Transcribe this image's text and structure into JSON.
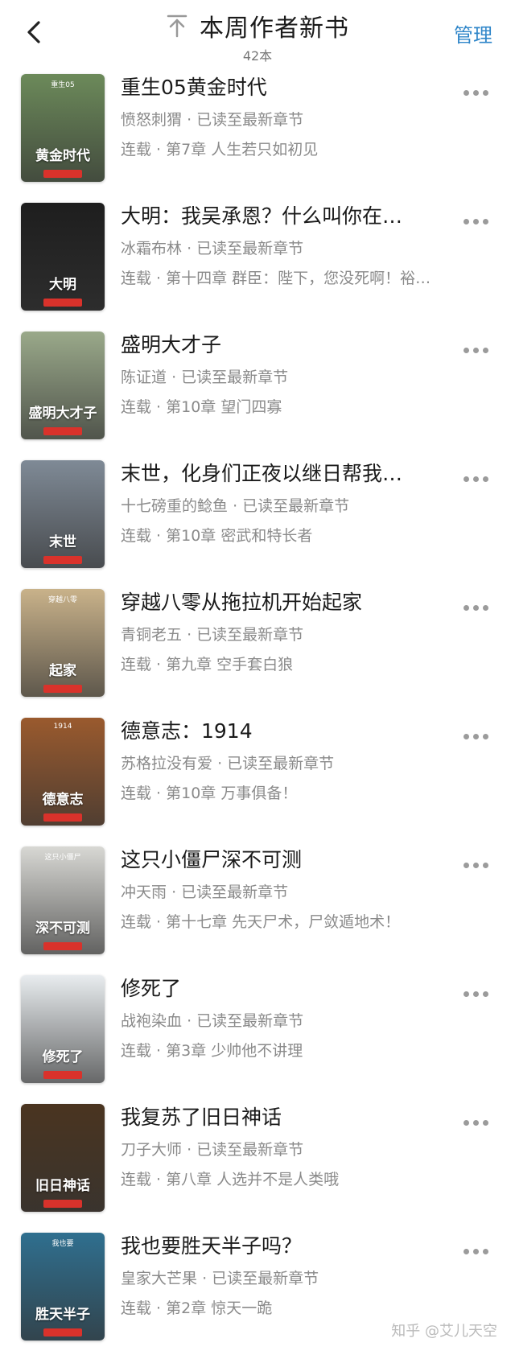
{
  "header": {
    "title": "本周作者新书",
    "count": "42本",
    "manage": "管理"
  },
  "books": [
    {
      "title": "重生05黄金时代",
      "author": "愤怒刺猬",
      "status": "已读至最新章节",
      "chapter": "连载 · 第7章 人生若只如初见",
      "cover_text": "黄金时代",
      "cover_top": "重生05",
      "cover_color": "#6c8a5a"
    },
    {
      "title": "大明：我吴承恩？什么叫你在…",
      "author": "冰霜布林",
      "status": "已读至最新章节",
      "chapter": "连载 · 第十四章 群臣：陛下，您没死啊！裕王…",
      "cover_text": "大明",
      "cover_top": "",
      "cover_color": "#1e1e1e"
    },
    {
      "title": "盛明大才子",
      "author": "陈证道",
      "status": "已读至最新章节",
      "chapter": "连载 · 第10章 望门四寡",
      "cover_text": "盛明大才子",
      "cover_top": "",
      "cover_color": "#9aa98a"
    },
    {
      "title": "末世，化身们正夜以继日帮我…",
      "author": "十七磅重的鲶鱼",
      "status": "已读至最新章节",
      "chapter": "连载 · 第10章 密武和特长者",
      "cover_text": "末世",
      "cover_top": "",
      "cover_color": "#7f8a96"
    },
    {
      "title": "穿越八零从拖拉机开始起家",
      "author": "青铜老五",
      "status": "已读至最新章节",
      "chapter": "连载 · 第九章 空手套白狼",
      "cover_text": "起家",
      "cover_top": "穿越八零",
      "cover_color": "#c9b28a"
    },
    {
      "title": "德意志：1914",
      "author": "苏格拉没有爱",
      "status": "已读至最新章节",
      "chapter": "连载 · 第10章 万事俱备！",
      "cover_text": "德意志",
      "cover_top": "1914",
      "cover_color": "#9a5a2e"
    },
    {
      "title": "这只小僵尸深不可测",
      "author": "冲天雨",
      "status": "已读至最新章节",
      "chapter": "连载 · 第十七章 先天尸术，尸敛遁地术！",
      "cover_text": "深不可测",
      "cover_top": "这只小僵尸",
      "cover_color": "#d8d8d4"
    },
    {
      "title": "修死了",
      "author": "战袍染血",
      "status": "已读至最新章节",
      "chapter": "连载 · 第3章 少帅他不讲理",
      "cover_text": "修死了",
      "cover_top": "",
      "cover_color": "#e8ecef"
    },
    {
      "title": "我复苏了旧日神话",
      "author": "刀子大师",
      "status": "已读至最新章节",
      "chapter": "连载 · 第八章 人选并不是人类哦",
      "cover_text": "旧日神话",
      "cover_top": "",
      "cover_color": "#4a3420"
    },
    {
      "title": "我也要胜天半子吗？",
      "author": "皇家大芒果",
      "status": "已读至最新章节",
      "chapter": "连载 · 第2章 惊天一跪",
      "cover_text": "胜天半子",
      "cover_top": "我也要",
      "cover_color": "#2f6f8f"
    }
  ],
  "watermark": "知乎 @艾儿天空"
}
